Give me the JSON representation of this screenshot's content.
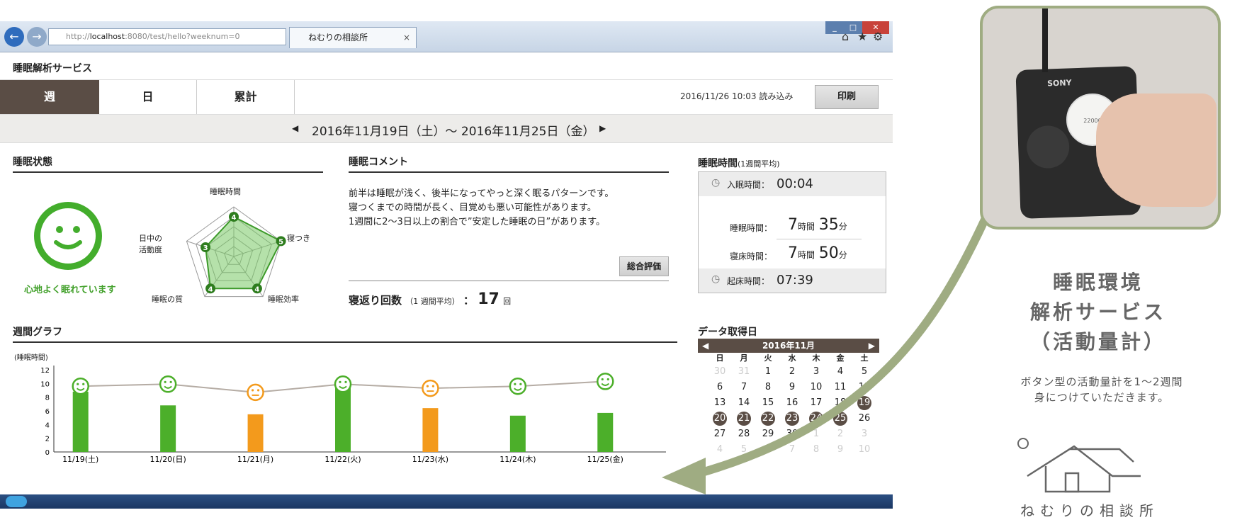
{
  "browser": {
    "url_prefix": "http://",
    "url_host": "localhost",
    "url_rest": ":8080/test/hello?weeknum=0",
    "tab_title": "ねむりの相談所"
  },
  "page": {
    "service_title": "睡眠解析サービス",
    "tabs": [
      {
        "label": "週",
        "active": true
      },
      {
        "label": "日",
        "active": false
      },
      {
        "label": "累計",
        "active": false
      }
    ],
    "timestamp": "2016/11/26 10:03 読み込み",
    "print_label": "印刷",
    "date_range": "2016年11月19日（土）～ 2016年11月25日（金）"
  },
  "sleep_status": {
    "heading": "睡眠状態",
    "status_text": "心地よく眠れています",
    "radar": {
      "labels": [
        "睡眠時間",
        "寝つき",
        "睡眠効率",
        "睡眠の質",
        "日中の",
        "活動度"
      ],
      "scores": [
        4,
        5,
        4,
        4,
        3
      ]
    }
  },
  "comment": {
    "heading": "睡眠コメント",
    "lines": [
      "前半は睡眠が浅く、後半になってやっと深く眠るパターンです。",
      "寝つくまでの時間が長く、目覚めも悪い可能性があります。",
      "1週間に2～3日以上の割合で”安定した睡眠の日”があります。"
    ],
    "eval_button": "総合評価",
    "turn_label": "寝返り回数",
    "turn_note": "（1 週間平均）",
    "turn_sep": "：",
    "turn_value": "17",
    "turn_unit": "回"
  },
  "sleep_time": {
    "heading": "睡眠時間",
    "heading_note": "(1週間平均)",
    "bed_label": "入眠時間：",
    "bed_value": "00:04",
    "dur_label": "睡眠時間：",
    "dur_h": "7",
    "dur_m": "35",
    "inbed_label": "寝床時間：",
    "inbed_h": "7",
    "inbed_m": "50",
    "unit_h": "時間",
    "unit_m": "分",
    "wake_label": "起床時間：",
    "wake_value": "07:39"
  },
  "calendar": {
    "heading": "データ取得日",
    "month": "2016年11月",
    "dow": [
      "日",
      "月",
      "火",
      "水",
      "木",
      "金",
      "土"
    ],
    "weeks": [
      [
        [
          "30",
          0
        ],
        [
          "31",
          0
        ],
        [
          "1",
          1
        ],
        [
          "2",
          1
        ],
        [
          "3",
          1
        ],
        [
          "4",
          1
        ],
        [
          "5",
          1
        ]
      ],
      [
        [
          "6",
          1
        ],
        [
          "7",
          1
        ],
        [
          "8",
          1
        ],
        [
          "9",
          1
        ],
        [
          "10",
          1
        ],
        [
          "11",
          1
        ],
        [
          "12",
          1
        ]
      ],
      [
        [
          "13",
          1
        ],
        [
          "14",
          1
        ],
        [
          "15",
          1
        ],
        [
          "16",
          1
        ],
        [
          "17",
          1
        ],
        [
          "18",
          1
        ],
        [
          "19",
          2
        ]
      ],
      [
        [
          "20",
          2
        ],
        [
          "21",
          2
        ],
        [
          "22",
          2
        ],
        [
          "23",
          2
        ],
        [
          "24",
          2
        ],
        [
          "25",
          2
        ],
        [
          "26",
          1
        ]
      ],
      [
        [
          "27",
          1
        ],
        [
          "28",
          1
        ],
        [
          "29",
          1
        ],
        [
          "30",
          1
        ],
        [
          "1",
          0
        ],
        [
          "2",
          0
        ],
        [
          "3",
          0
        ]
      ],
      [
        [
          "4",
          0
        ],
        [
          "5",
          0
        ],
        [
          "6",
          0
        ],
        [
          "7",
          0
        ],
        [
          "8",
          0
        ],
        [
          "9",
          0
        ],
        [
          "10",
          0
        ]
      ]
    ]
  },
  "weekly": {
    "heading": "週間グラフ",
    "ylabel": "(睡眠時間)"
  },
  "chart_data": {
    "type": "bar",
    "categories": [
      "11/19(土)",
      "11/20(日)",
      "11/21(月)",
      "11/22(火)",
      "11/23(水)",
      "11/24(木)",
      "11/25(金)"
    ],
    "values": [
      8.8,
      6.8,
      5.5,
      9.4,
      6.4,
      5.3,
      5.7
    ],
    "line_values": [
      9.6,
      9.9,
      8.7,
      9.9,
      9.3,
      9.6,
      10.3
    ],
    "moods": [
      "good",
      "good",
      "ok",
      "good",
      "ok",
      "good",
      "good"
    ],
    "ylim": [
      0,
      12
    ],
    "yticks": [
      0,
      2,
      4,
      6,
      8,
      10,
      12
    ],
    "colors": {
      "good": "#4caf2a",
      "ok": "#f39a1c",
      "line": "#b5aca4"
    }
  },
  "promo": {
    "title_lines": [
      "睡眠環境",
      "解析サービス",
      "（活動量計）"
    ],
    "sub_lines": [
      "ボタン型の活動量計を1～2週間",
      "身につけていただきます。"
    ],
    "logo_text": "ねむりの相談所",
    "reader_brand": "SONY",
    "sensor_code": "22000"
  },
  "colors": {
    "green": "#43ad2c",
    "arrow": "#9fac82",
    "brown": "#5a4d45"
  }
}
